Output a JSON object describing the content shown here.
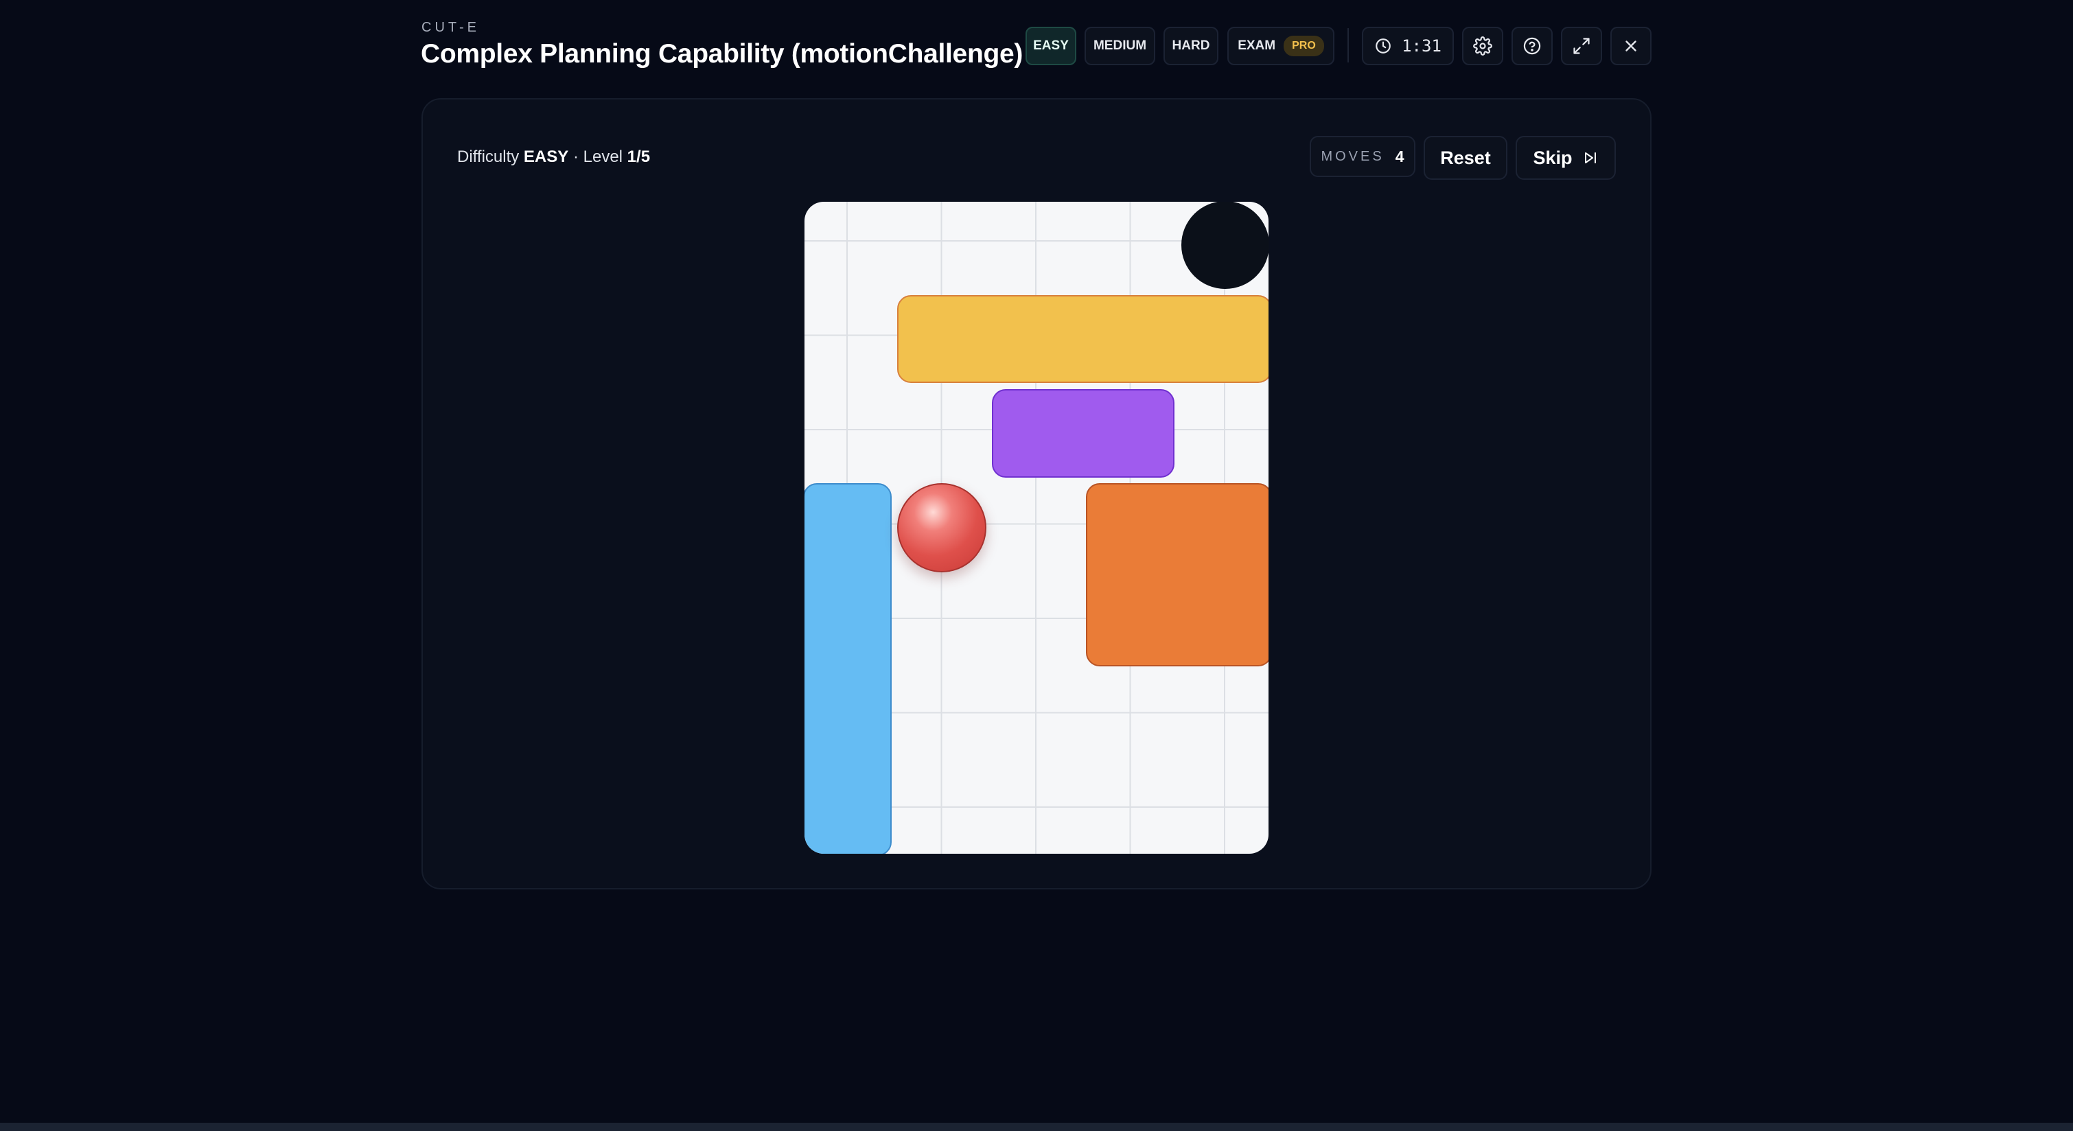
{
  "header": {
    "brand": "CUT-E",
    "title": "Complex Planning Capability (motionChallenge)"
  },
  "difficulty_buttons": {
    "easy": "EASY",
    "medium": "MEDIUM",
    "hard": "HARD",
    "exam": "EXAM",
    "exam_badge": "PRO",
    "active": "EASY"
  },
  "timer": {
    "value": "1:31"
  },
  "status": {
    "difficulty_label": "Difficulty",
    "difficulty_value": "EASY",
    "separator": "·",
    "level_label": "Level",
    "level_value": "1/5"
  },
  "moves": {
    "label": "MOVES",
    "value": "4"
  },
  "actions": {
    "reset_label": "Reset",
    "skip_label": "Skip"
  },
  "board": {
    "background_color": "#f6f7f9",
    "pieces": [
      {
        "name": "yellow-block",
        "color": "#f2c14d"
      },
      {
        "name": "purple-block",
        "color": "#a05bee"
      },
      {
        "name": "blue-block",
        "color": "#65bcf3"
      },
      {
        "name": "orange-block",
        "color": "#ea7c37"
      }
    ],
    "ball_color": "#df504b",
    "goal_color": "#0b1019"
  },
  "colors": {
    "page_background": "#060a17",
    "card_background": "#0a0f1c",
    "active_button": "#10272a",
    "pro_badge": "#f4c14d"
  }
}
